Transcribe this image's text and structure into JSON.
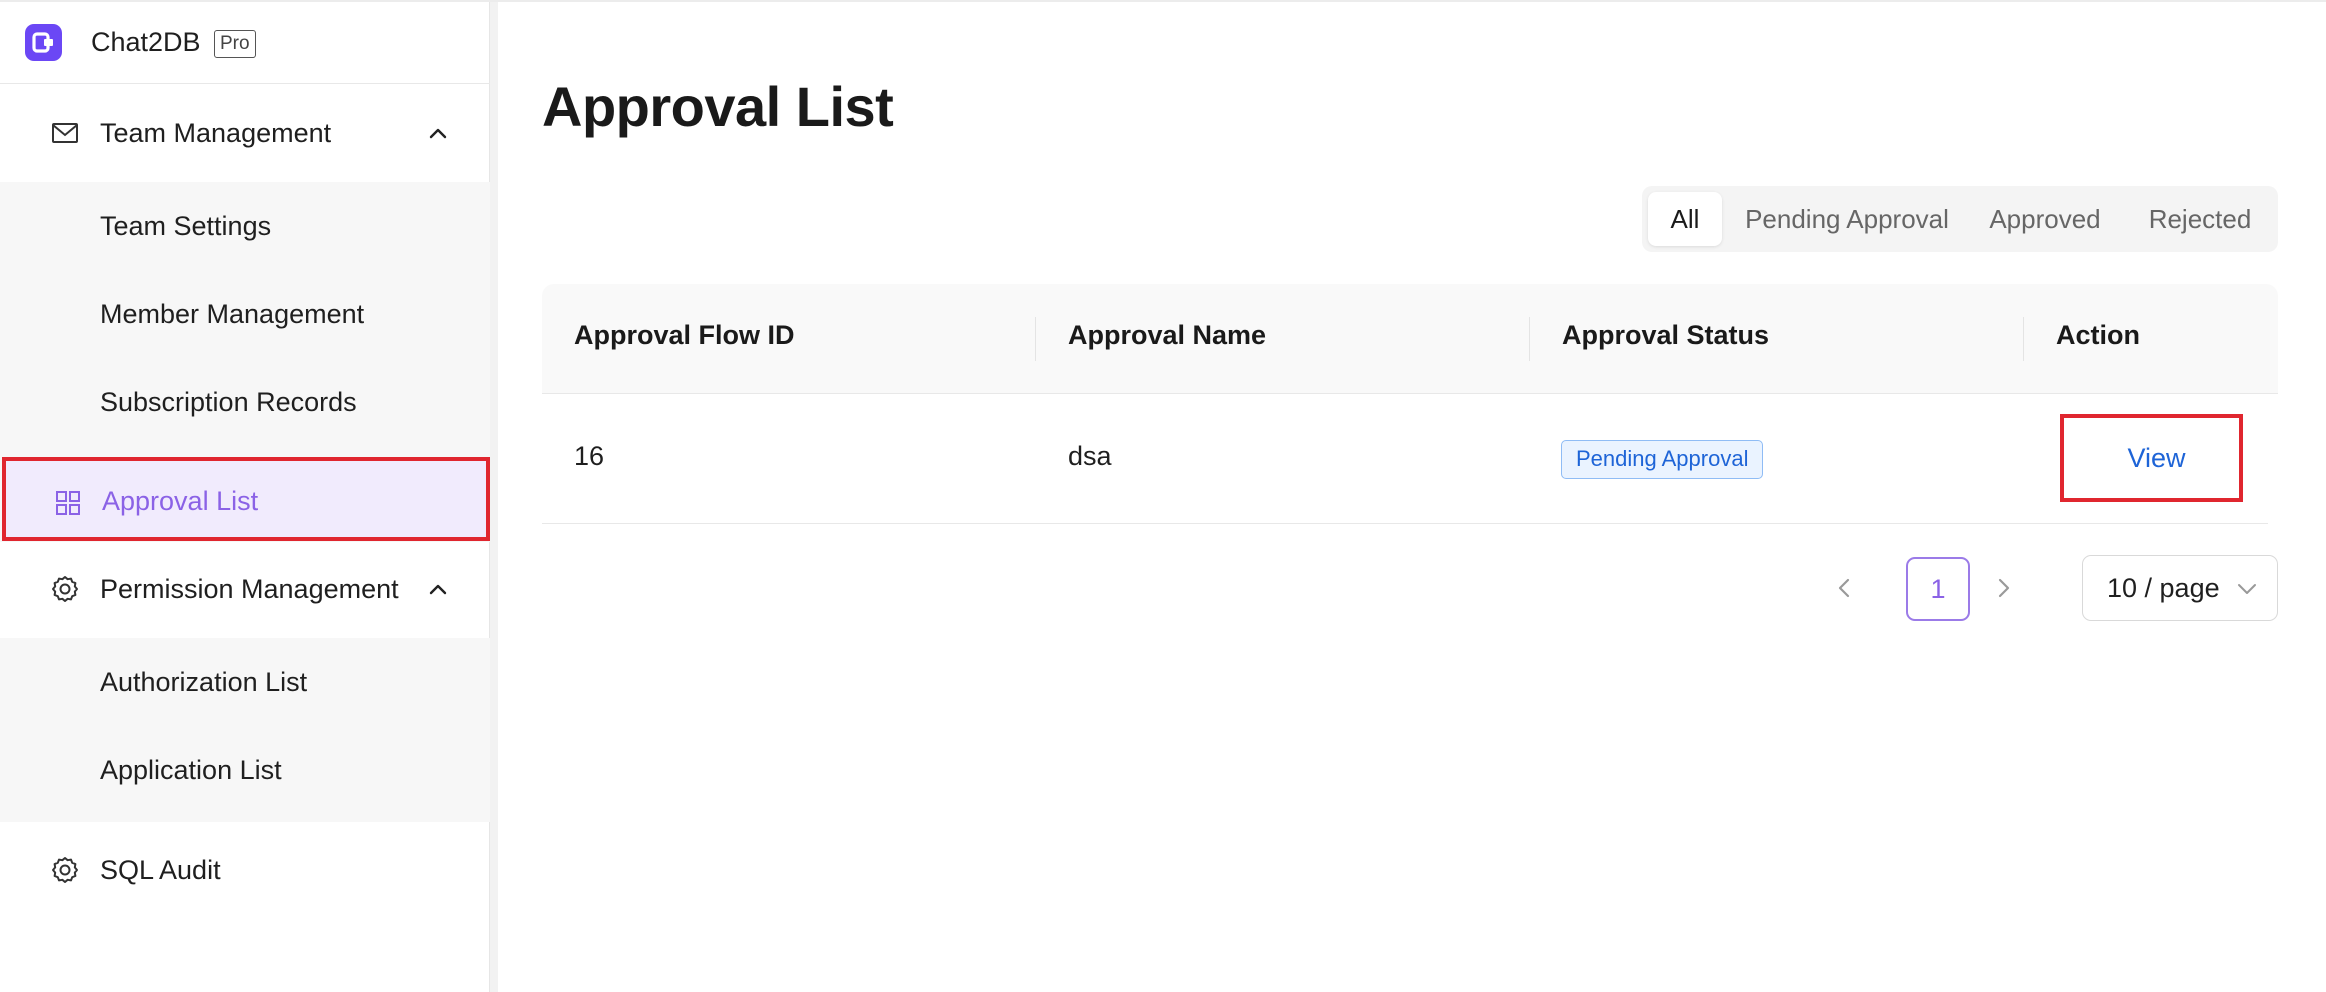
{
  "brand": {
    "name": "Chat2DB",
    "badge": "Pro"
  },
  "sidebar": {
    "groups": [
      {
        "label": "Team Management",
        "icon": "mail-icon",
        "expanded": true,
        "items": [
          {
            "label": "Team Settings"
          },
          {
            "label": "Member Management"
          },
          {
            "label": "Subscription Records"
          },
          {
            "label": "Approval List",
            "icon": "grid-icon",
            "active": true
          }
        ]
      },
      {
        "label": "Permission Management",
        "icon": "gear-icon",
        "expanded": true,
        "items": [
          {
            "label": "Authorization List"
          },
          {
            "label": "Application List"
          }
        ]
      },
      {
        "label": "SQL Audit",
        "icon": "gear-icon"
      }
    ]
  },
  "main": {
    "title": "Approval List",
    "tabs": [
      {
        "label": "All",
        "selected": true
      },
      {
        "label": "Pending Approval"
      },
      {
        "label": "Approved"
      },
      {
        "label": "Rejected"
      }
    ],
    "table": {
      "columns": [
        "Approval Flow ID",
        "Approval Name",
        "Approval Status",
        "Action"
      ],
      "rows": [
        {
          "id": "16",
          "name": "dsa",
          "status": "Pending Approval",
          "action": "View"
        }
      ]
    },
    "pagination": {
      "current_page": "1",
      "page_size": "10 / page"
    }
  },
  "colors": {
    "accent": "#8b62e6",
    "brand": "#6b47f5",
    "link": "#1e64d7",
    "highlight_box": "#e0262f",
    "status_bg": "#eaf3ff",
    "status_border": "#8fbcf5"
  }
}
